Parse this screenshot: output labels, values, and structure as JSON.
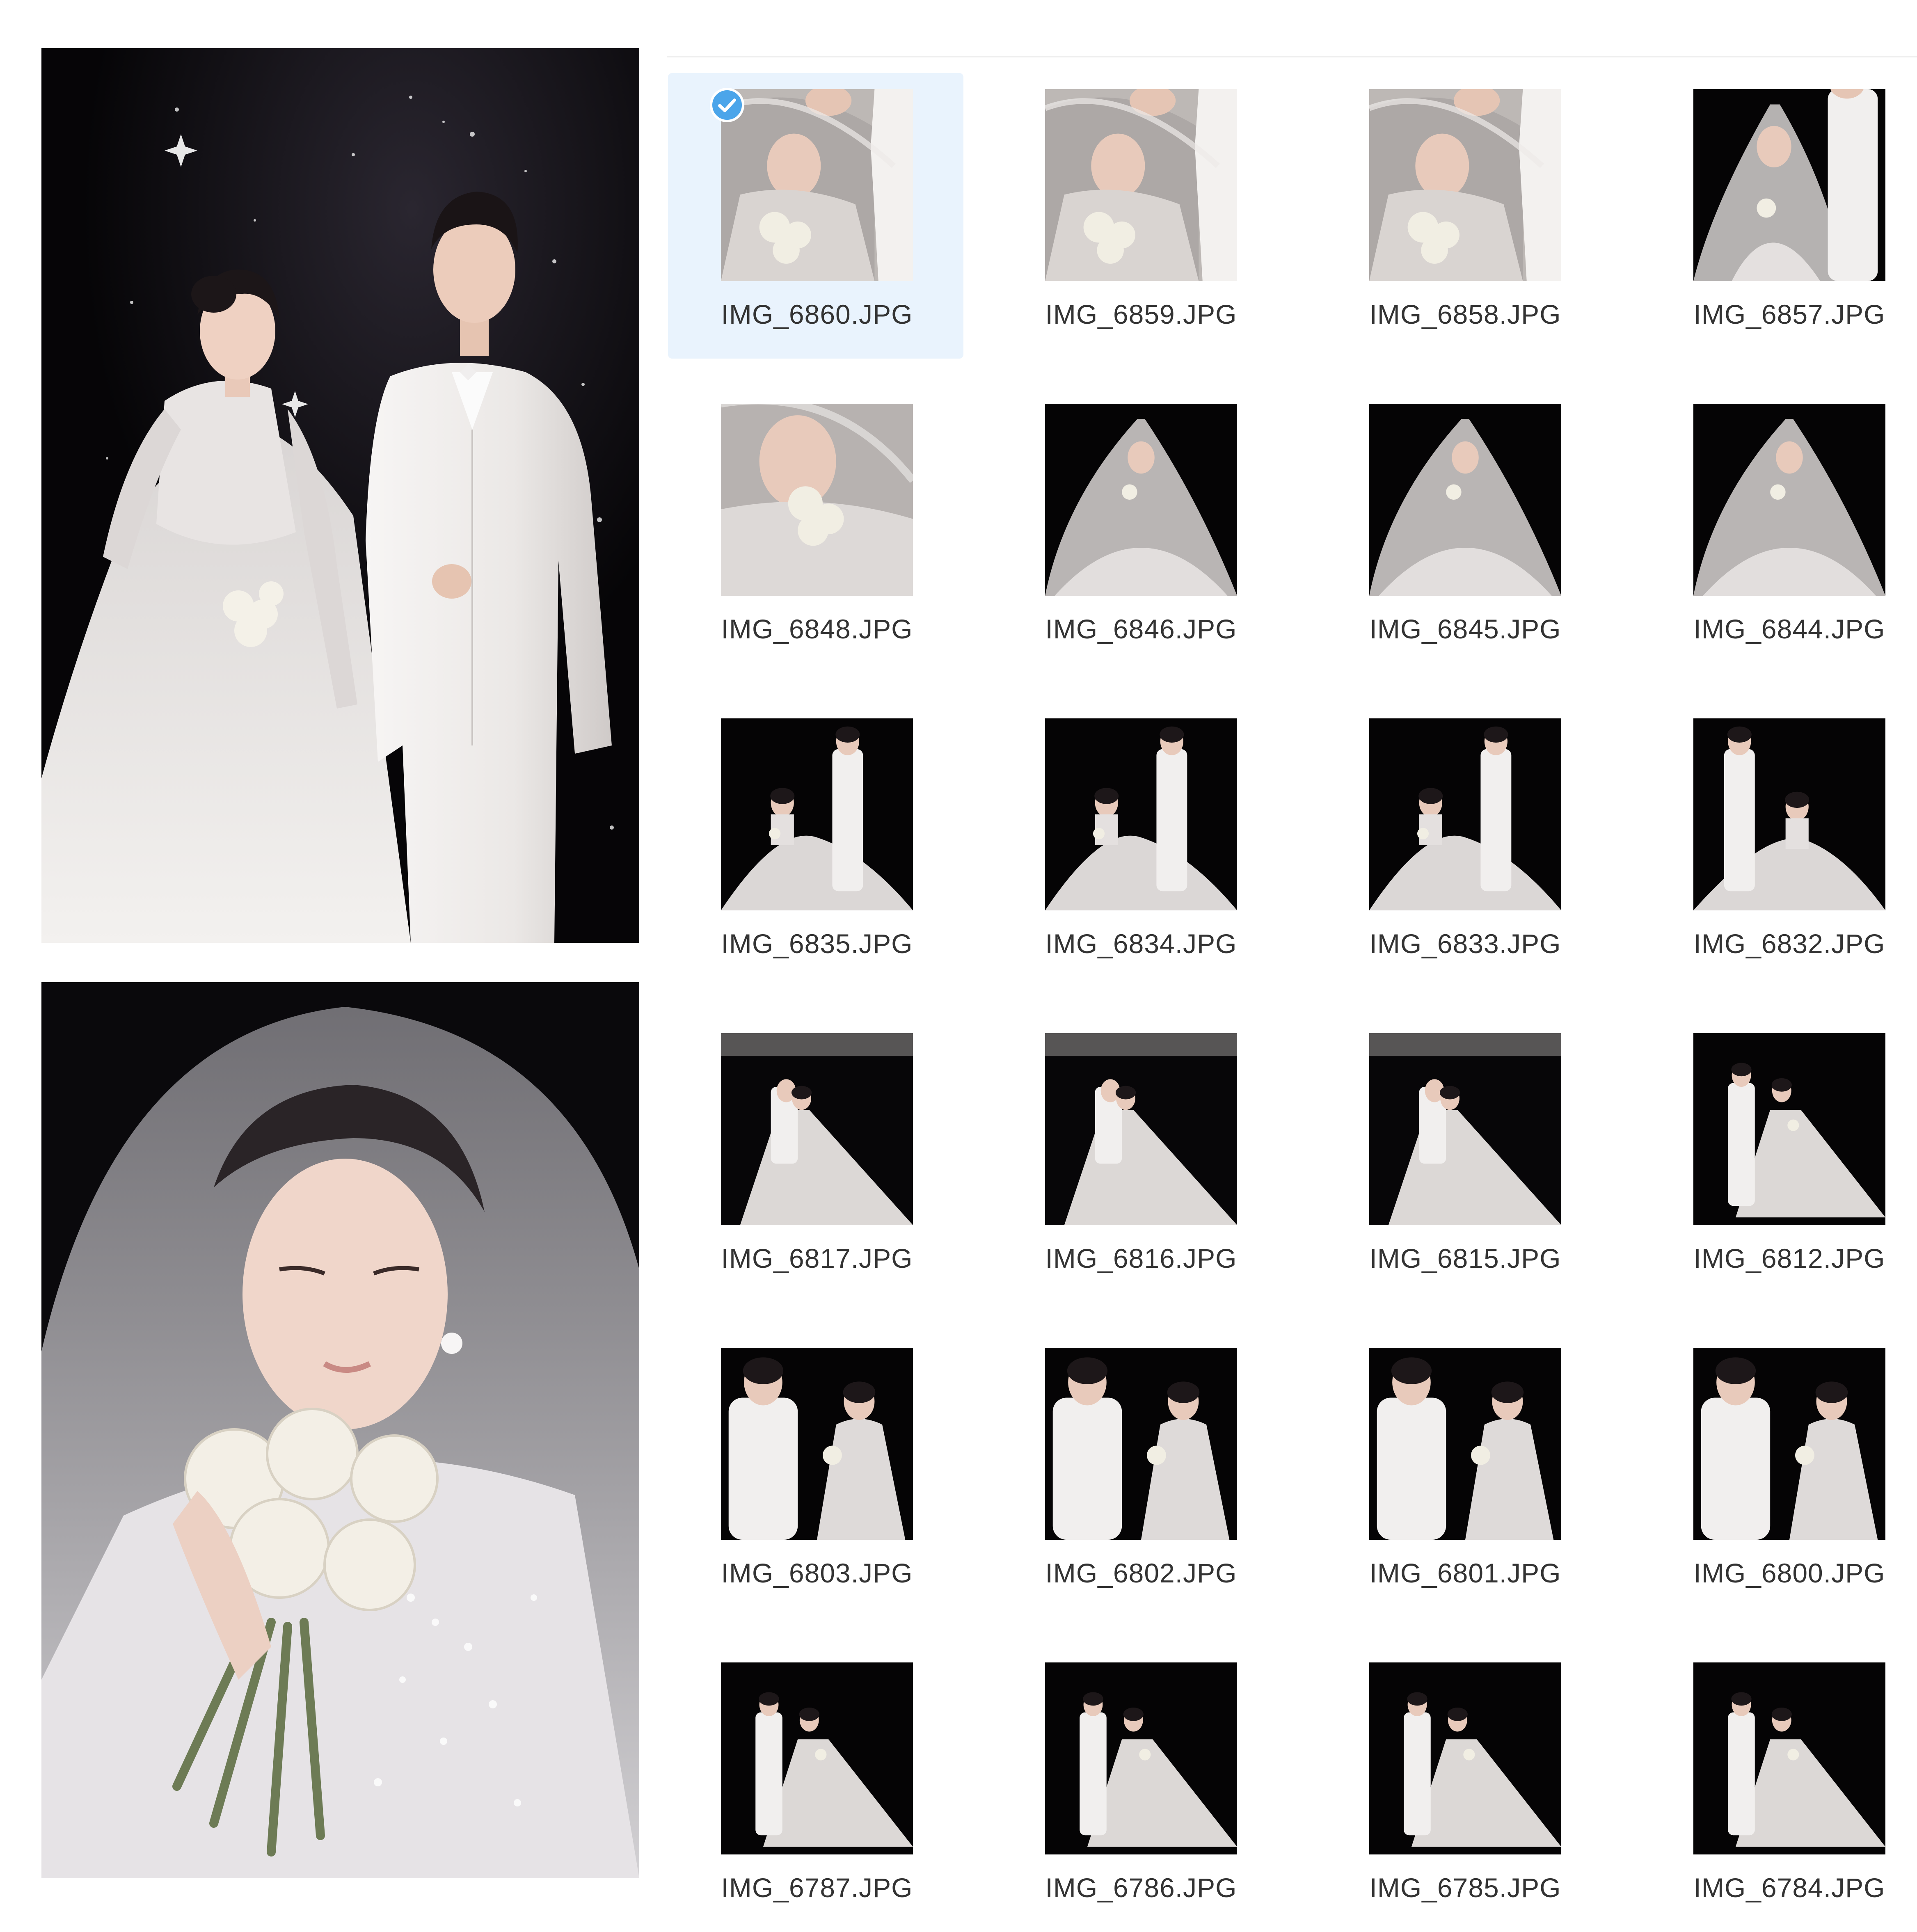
{
  "colors": {
    "selection_background": "#e9f3fd",
    "checkmark_badge": "#4ba5ea",
    "filename_text": "#333333",
    "photo_backdrop": "#050405"
  },
  "preview_panel": {
    "images": [
      {
        "subject": "bride-and-groom-standing-portrait"
      },
      {
        "subject": "veiled-bride-with-rose-bouquet"
      }
    ]
  },
  "file_grid": {
    "selected_index": 0,
    "checkmark_icon": "check-circle-icon",
    "files": [
      {
        "name": "IMG_6860.JPG",
        "scene": "veil-kiss"
      },
      {
        "name": "IMG_6859.JPG",
        "scene": "veil-kiss"
      },
      {
        "name": "IMG_6858.JPG",
        "scene": "veil-kiss"
      },
      {
        "name": "IMG_6857.JPG",
        "scene": "veil-groom"
      },
      {
        "name": "IMG_6848.JPG",
        "scene": "veil-closeup"
      },
      {
        "name": "IMG_6846.JPG",
        "scene": "veil-seated"
      },
      {
        "name": "IMG_6845.JPG",
        "scene": "veil-seated"
      },
      {
        "name": "IMG_6844.JPG",
        "scene": "veil-seated"
      },
      {
        "name": "IMG_6835.JPG",
        "scene": "seated-couple"
      },
      {
        "name": "IMG_6834.JPG",
        "scene": "seated-couple"
      },
      {
        "name": "IMG_6833.JPG",
        "scene": "seated-couple"
      },
      {
        "name": "IMG_6832.JPG",
        "scene": "seated-couple-left"
      },
      {
        "name": "IMG_6817.JPG",
        "scene": "embrace-wide"
      },
      {
        "name": "IMG_6816.JPG",
        "scene": "embrace-wide"
      },
      {
        "name": "IMG_6815.JPG",
        "scene": "embrace-wide"
      },
      {
        "name": "IMG_6812.JPG",
        "scene": "standing-wide"
      },
      {
        "name": "IMG_6803.JPG",
        "scene": "couple-medium"
      },
      {
        "name": "IMG_6802.JPG",
        "scene": "couple-medium"
      },
      {
        "name": "IMG_6801.JPG",
        "scene": "couple-medium"
      },
      {
        "name": "IMG_6800.JPG",
        "scene": "couple-medium"
      },
      {
        "name": "IMG_6787.JPG",
        "scene": "standing-wide"
      },
      {
        "name": "IMG_6786.JPG",
        "scene": "standing-wide"
      },
      {
        "name": "IMG_6785.JPG",
        "scene": "standing-wide"
      },
      {
        "name": "IMG_6784.JPG",
        "scene": "standing-wide"
      }
    ]
  }
}
